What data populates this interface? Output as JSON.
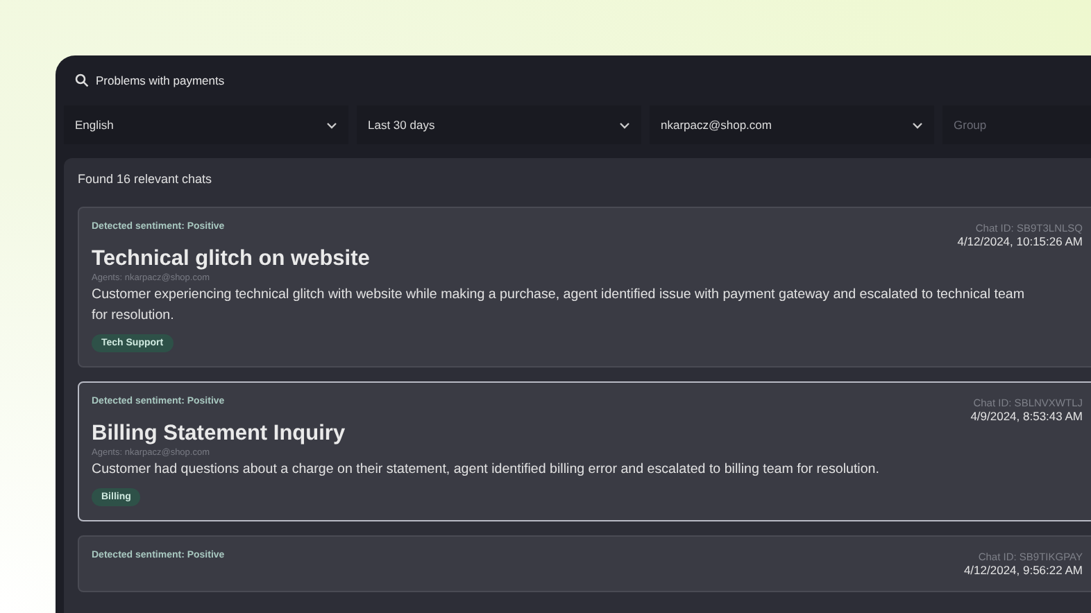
{
  "search": {
    "value": "Problems with payments"
  },
  "filters": [
    {
      "kind": "select",
      "value": "English"
    },
    {
      "kind": "select",
      "value": "Last 30 days"
    },
    {
      "kind": "select",
      "value": "nkarpacz@shop.com"
    },
    {
      "kind": "input",
      "placeholder": "Group"
    }
  ],
  "results": {
    "summary": "Found 16 relevant chats",
    "chats": [
      {
        "sentiment": "Detected sentiment: Positive",
        "chat_id": "Chat ID: SB9T3LNLSQ",
        "date": "4/12/2024, 10:15:26 AM",
        "title": "Technical glitch on website",
        "agents": "Agents: nkarpacz@shop.com",
        "summary": "Customer experiencing technical glitch with website while making a purchase, agent identified issue with payment gateway and escalated to technical team for resolution.",
        "tag": "Tech Support",
        "selected": false
      },
      {
        "sentiment": "Detected sentiment: Positive",
        "chat_id": "Chat ID: SBLNVXWTLJ",
        "date": "4/9/2024, 8:53:43 AM",
        "title": "Billing Statement Inquiry",
        "agents": "Agents: nkarpacz@shop.com",
        "summary": "Customer had questions about a charge on their statement, agent identified billing error and escalated to billing team for resolution.",
        "tag": "Billing",
        "selected": true
      },
      {
        "sentiment": "Detected sentiment: Positive",
        "chat_id": "Chat ID: SB9TIKGPAY",
        "date": "4/12/2024, 9:56:22 AM",
        "selected": false
      }
    ]
  }
}
